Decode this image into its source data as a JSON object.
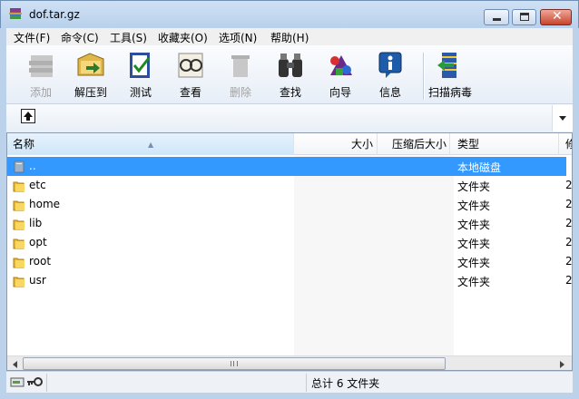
{
  "window": {
    "title": "dof.tar.gz"
  },
  "menu": [
    {
      "label": "文件(F)"
    },
    {
      "label": "命令(C)"
    },
    {
      "label": "工具(S)"
    },
    {
      "label": "收藏夹(O)"
    },
    {
      "label": "选项(N)"
    },
    {
      "label": "帮助(H)"
    }
  ],
  "toolbar": {
    "items": [
      {
        "label": "添加",
        "icon": "add-icon",
        "enabled": false
      },
      {
        "label": "解压到",
        "icon": "extract-icon",
        "enabled": true
      },
      {
        "label": "测试",
        "icon": "test-icon",
        "enabled": true
      },
      {
        "label": "查看",
        "icon": "view-icon",
        "enabled": true
      },
      {
        "label": "删除",
        "icon": "delete-icon",
        "enabled": false
      },
      {
        "label": "查找",
        "icon": "find-icon",
        "enabled": true
      },
      {
        "label": "向导",
        "icon": "wizard-icon",
        "enabled": true
      },
      {
        "label": "信息",
        "icon": "info-icon",
        "enabled": true
      },
      {
        "label": "扫描病毒",
        "icon": "virus-scan-icon",
        "enabled": true
      }
    ]
  },
  "columns": {
    "name": "名称",
    "size": "大小",
    "packed": "压缩后大小",
    "type": "类型",
    "modified": "修"
  },
  "files": [
    {
      "name": "..",
      "type": "本地磁盘",
      "modified": "",
      "selected": true,
      "icon": "drive-icon"
    },
    {
      "name": "etc",
      "type": "文件夹",
      "modified": "2",
      "selected": false,
      "icon": "folder-icon"
    },
    {
      "name": "home",
      "type": "文件夹",
      "modified": "2",
      "selected": false,
      "icon": "folder-icon"
    },
    {
      "name": "lib",
      "type": "文件夹",
      "modified": "2",
      "selected": false,
      "icon": "folder-icon"
    },
    {
      "name": "opt",
      "type": "文件夹",
      "modified": "2",
      "selected": false,
      "icon": "folder-icon"
    },
    {
      "name": "root",
      "type": "文件夹",
      "modified": "2",
      "selected": false,
      "icon": "folder-icon"
    },
    {
      "name": "usr",
      "type": "文件夹",
      "modified": "2",
      "selected": false,
      "icon": "folder-icon"
    }
  ],
  "status": {
    "text": "总计 6 文件夹"
  },
  "colors": {
    "selection": "#3399ff",
    "titlebar": "#c4d8ef"
  }
}
